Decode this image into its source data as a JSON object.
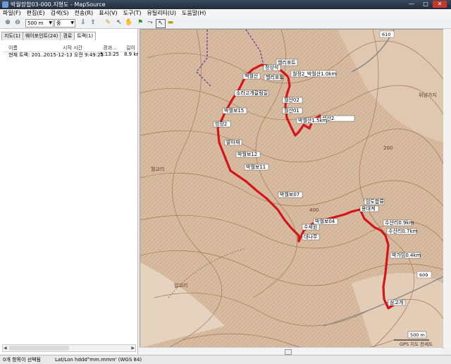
{
  "window": {
    "title": "박월장합03-000.지형도 - MapSource",
    "min": "—",
    "max": "□",
    "close": "✕"
  },
  "menu": [
    "파일(F)",
    "편집(E)",
    "검색(S)",
    "전송(R)",
    "표시(V)",
    "도구(T)",
    "유틸리티(U)",
    "도움말(H)"
  ],
  "toolbar": {
    "scale_value": "500 m",
    "detail_value": "중"
  },
  "tabs": [
    "지도(1)",
    "웨이포인트(24)",
    "경로",
    "트랙(1)"
  ],
  "track_table": {
    "headers": [
      "이름",
      "시작 시간",
      "경과...",
      "길이"
    ],
    "rows": [
      [
        "현재 트랙: 201...",
        "2015-12-13 오전 9:49:25",
        "5:13:25",
        "8.9 kr"
      ]
    ]
  },
  "waypoints": [
    "헬리포트",
    "정상석",
    "백월산",
    "헬리포트",
    "월정2_박월산1.0km",
    "월산02",
    "월산01",
    "석산2",
    "소라고개갈림길",
    "박월산1.5km",
    "박월보15",
    "빙장2",
    "발아재",
    "박월보12",
    "박월보11",
    "박월보07",
    "박월보04",
    "수세원",
    "임도합류",
    "용대계",
    "대나무",
    "임대고개",
    "수산리0.9km",
    "수산리0.7km",
    "박가임0.4km",
    "삼고개"
  ],
  "map_labels": {
    "peak_400": "400",
    "peak_200": "200",
    "road_610": "610",
    "road_609": "609",
    "bridge": "월교리",
    "village1": "위남가지",
    "village2": "빌교리",
    "scale": "500 m",
    "copyright": "GPS 지도 전세도"
  },
  "status": {
    "left": "0개 항목이 선택됨",
    "coord": "Lat/Lon hddd°mm.mmm' (WGS 84)"
  },
  "colors": {
    "track": "#d4151a",
    "terrain": "#c9a88a",
    "contour": "#9c6f52",
    "waypoint_box": "#ffffff"
  }
}
